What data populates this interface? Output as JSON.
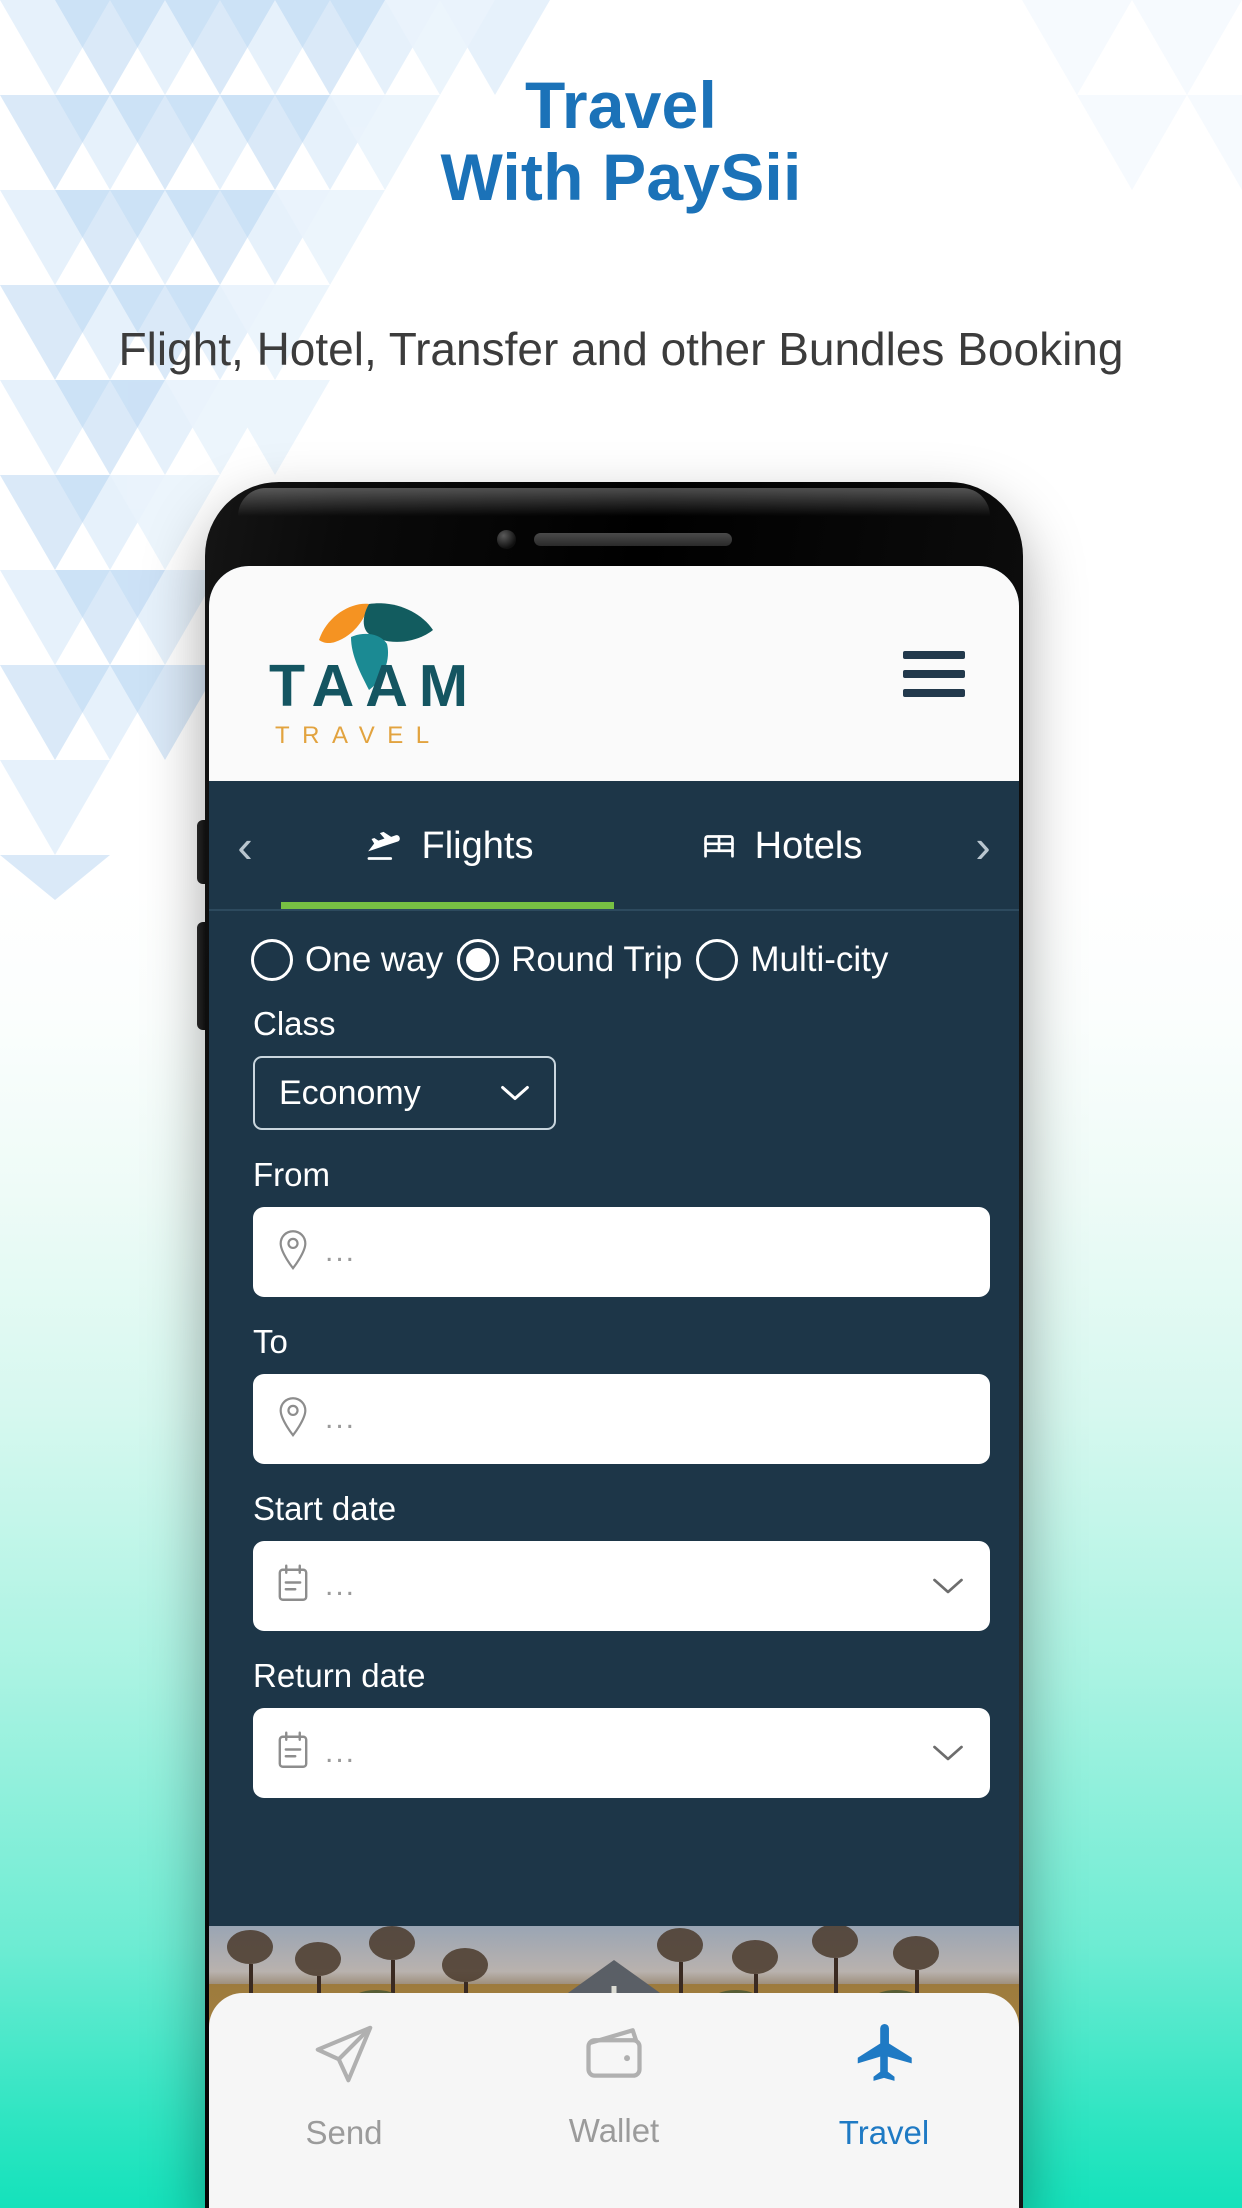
{
  "hero": {
    "title_line1": "Travel",
    "title_line2": "With PaySii",
    "subtitle": "Flight, Hotel, Transfer and other Bundles Booking",
    "title_color": "#1b72b8",
    "subtitle_color": "#3c3c3c"
  },
  "app": {
    "header": {
      "logo_wordmark": "TAAM",
      "logo_subwordmark": "TRAVEL",
      "logo_mark_name": "taam-palm-leaf-logo",
      "menu_icon": "hamburger-menu-icon",
      "logo_teal": "#145561",
      "logo_orange": "#e2a33f",
      "background": "#fafafa"
    },
    "tabs": {
      "prev_arrow": "‹",
      "next_arrow": "›",
      "items": [
        {
          "label": "Flights",
          "icon": "flight-takeoff-icon",
          "active": true
        },
        {
          "label": "Hotels",
          "icon": "hotel-bed-icon",
          "active": false
        }
      ],
      "active_underline_color": "#77c043",
      "background": "#1d3648"
    },
    "form": {
      "trip_types": [
        {
          "label": "One way",
          "selected": false
        },
        {
          "label": "Round Trip",
          "selected": true
        },
        {
          "label": "Multi-city",
          "selected": false
        }
      ],
      "class_label": "Class",
      "class_value": "Economy",
      "class_chevron": "chevron-down-icon",
      "fields": [
        {
          "label": "From",
          "placeholder": "...",
          "icon": "location-pin-icon",
          "has_chevron": false
        },
        {
          "label": "To",
          "placeholder": "...",
          "icon": "location-pin-icon",
          "has_chevron": false
        },
        {
          "label": "Start date",
          "placeholder": "...",
          "icon": "calendar-icon",
          "has_chevron": true
        },
        {
          "label": "Return date",
          "placeholder": "...",
          "icon": "calendar-icon",
          "has_chevron": true
        }
      ]
    },
    "banner": {
      "name": "savanna-road-photo-banner"
    },
    "bottom_nav": [
      {
        "label": "Send",
        "icon": "send-paper-plane-icon",
        "active": false
      },
      {
        "label": "Wallet",
        "icon": "wallet-icon",
        "active": false
      },
      {
        "label": "Travel",
        "icon": "airplane-icon",
        "active": true
      }
    ],
    "accent_color": "#1f7ac4",
    "inactive_color": "#9b9b9b"
  }
}
